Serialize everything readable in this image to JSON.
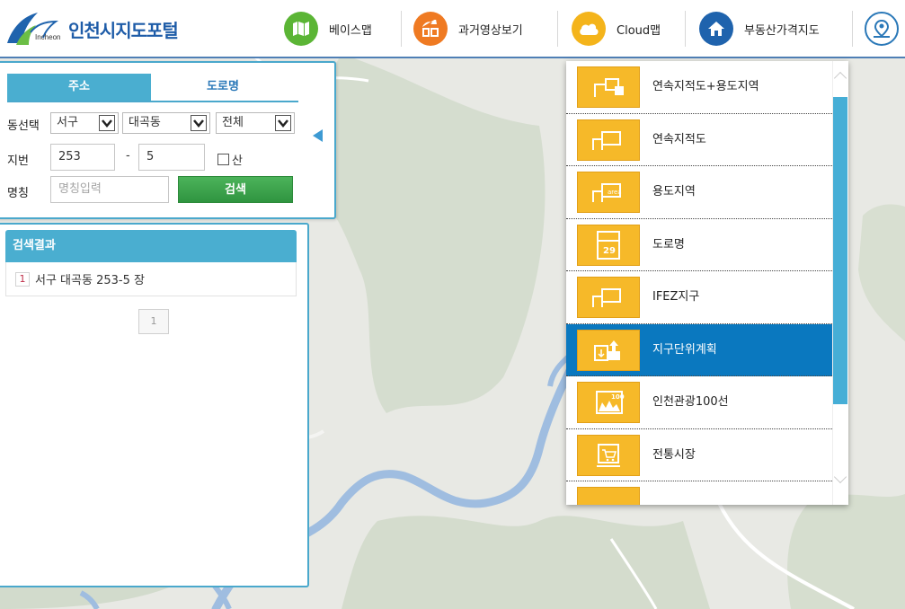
{
  "header": {
    "logo_small": "Incheon",
    "title": "인천시지도포털",
    "nav": [
      {
        "label": "베이스맵",
        "icon": "map-icon",
        "color": "#5bb535"
      },
      {
        "label": "과거영상보기",
        "icon": "history-icon",
        "color": "#ef7a22"
      },
      {
        "label": "Cloud맵",
        "icon": "cloud-icon",
        "color": "#f4b41b"
      },
      {
        "label": "부동산가격지도",
        "icon": "home-icon",
        "color": "#1f63ad"
      }
    ]
  },
  "search": {
    "tabs": [
      "주소",
      "도로명"
    ],
    "labels": {
      "dong": "동선택",
      "jibun": "지번",
      "name": "명칭"
    },
    "selects": {
      "gu": "서구",
      "dong": "대곡동",
      "type": "전체"
    },
    "jibun_main": "253",
    "dash": "-",
    "jibun_sub": "5",
    "mountain_label": "산",
    "name_placeholder": "명칭입력",
    "search_button": "검색"
  },
  "results": {
    "header": "검색결과",
    "items": [
      {
        "num": "1",
        "text": "서구 대곡동 253-5 장"
      }
    ],
    "page": "1"
  },
  "layers": {
    "items": [
      {
        "label": "연속지적도+용도지역",
        "icon": "cadastral-zone-icon",
        "selected": false
      },
      {
        "label": "연속지적도",
        "icon": "cadastral-icon",
        "selected": false
      },
      {
        "label": "용도지역",
        "icon": "zoning-area-icon",
        "selected": false
      },
      {
        "label": "도로명",
        "icon": "road-sign-icon",
        "selected": false
      },
      {
        "label": "IFEZ지구",
        "icon": "ifez-icon",
        "selected": false
      },
      {
        "label": "지구단위계획",
        "icon": "district-plan-icon",
        "selected": true
      },
      {
        "label": "인천관광100선",
        "icon": "tourism-icon",
        "selected": false
      },
      {
        "label": "전통시장",
        "icon": "market-icon",
        "selected": false
      },
      {
        "label": "",
        "icon": "layer-icon",
        "selected": false
      }
    ],
    "road_icon_number": "29",
    "area_icon_text": "area",
    "tourism_icon_text": "100"
  },
  "colors": {
    "accent": "#4aaed0",
    "header_line": "#4f7fb5",
    "layer_icon_bg": "#f6b929",
    "selected_row": "#0a78bf",
    "river": "#9fbde0"
  }
}
